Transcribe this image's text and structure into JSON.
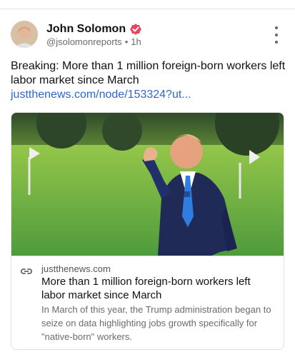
{
  "author": {
    "name": "John Solomon",
    "handle": "@jsolomonreports",
    "separator": "•",
    "time": "1h",
    "verified_color": "#e8465b"
  },
  "post": {
    "text": "Breaking: More than 1 million foreign-born workers left labor market since March ",
    "link_text": "justthenews.com/node/153324?ut..."
  },
  "card": {
    "domain": "justthenews.com",
    "title": "More than 1 million foreign-born workers left labor market since March",
    "description": "In March of this year, the Trump administration began to seize on data highlighting jobs growth specifically for \"native-born\" workers."
  },
  "colors": {
    "link": "#2e67c9",
    "muted": "#6b6b6b"
  },
  "icons": {
    "more": "vertical-ellipsis",
    "verified": "verified-badge",
    "link": "chain-link"
  }
}
